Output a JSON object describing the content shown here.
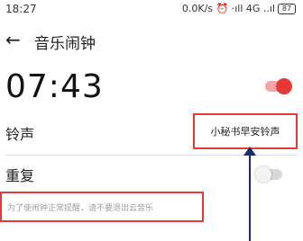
{
  "status_bar": {
    "time": "18:27",
    "indicators": "0.0K/s ⏰ ·ıll 4G ..ıl",
    "battery": "87"
  },
  "header": {
    "title": "音乐闹钟",
    "back_icon": "arrow-left-icon"
  },
  "alarm": {
    "time": "07:43",
    "enabled": true
  },
  "ringtone": {
    "label": "铃声",
    "value": "小秘书早安铃声"
  },
  "repeat": {
    "label": "重复",
    "enabled": false
  },
  "hint": {
    "text": "为了使闹钟正常提醒，请不要退出云音乐"
  },
  "colors": {
    "accent": "#e53935",
    "annotation_box": "#e53935",
    "arrow": "#1a2a6c"
  }
}
